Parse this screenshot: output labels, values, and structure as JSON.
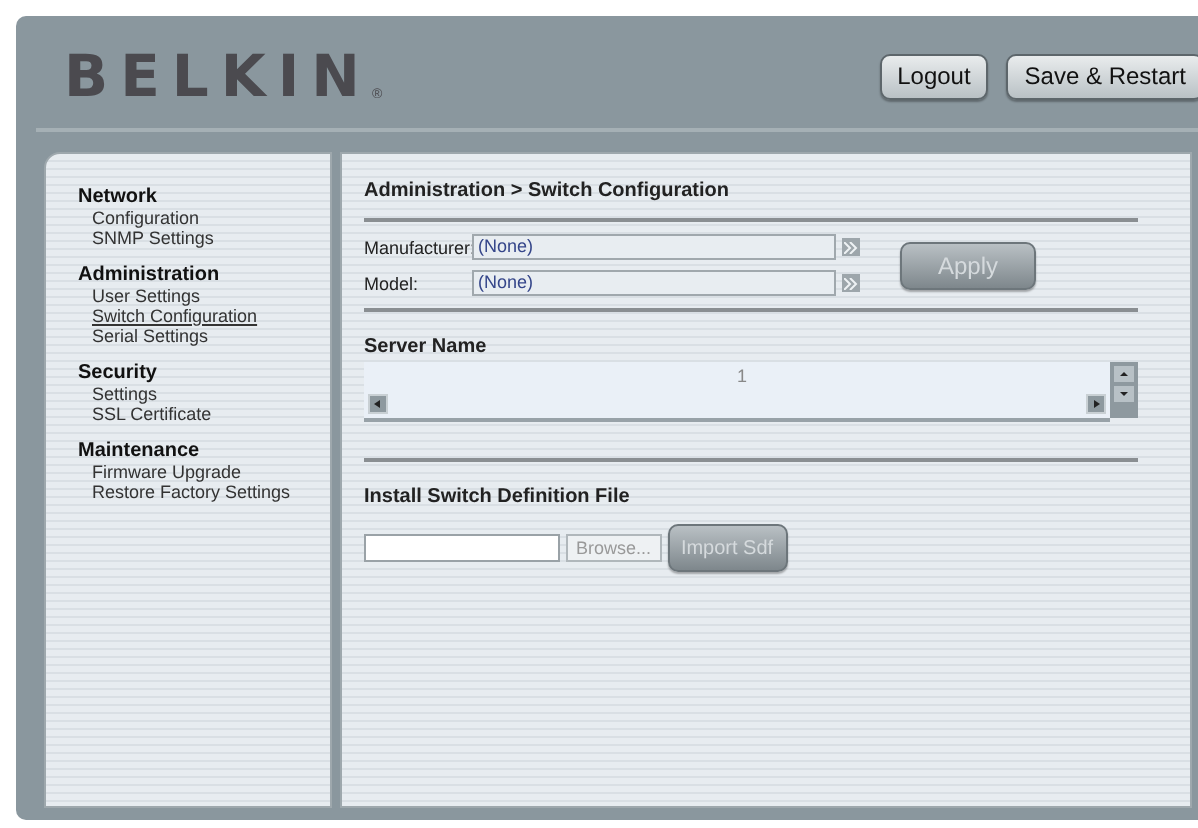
{
  "header": {
    "logo": "BELKIN",
    "logo_mark": "®",
    "buttons": [
      {
        "label": "Logout",
        "disabled": false
      },
      {
        "label": "Save & Restart",
        "disabled": false
      }
    ]
  },
  "sidebar": {
    "sections": [
      {
        "title": "Network",
        "items": [
          {
            "label": "Configuration",
            "selected": false
          },
          {
            "label": "SNMP Settings",
            "selected": false
          }
        ]
      },
      {
        "title": "Administration",
        "items": [
          {
            "label": "User Settings",
            "selected": false
          },
          {
            "label": "Switch Configuration",
            "selected": true
          },
          {
            "label": "Serial Settings",
            "selected": false
          }
        ]
      },
      {
        "title": "Security",
        "items": [
          {
            "label": "Settings",
            "selected": false
          },
          {
            "label": "SSL Certificate",
            "selected": false
          }
        ]
      },
      {
        "title": "Maintenance",
        "items": [
          {
            "label": "Firmware Upgrade",
            "selected": false
          },
          {
            "label": "Restore Factory Settings",
            "selected": false
          }
        ]
      }
    ]
  },
  "content": {
    "breadcrumb": "Administration > Switch Configuration",
    "fields": [
      {
        "label": "Manufacturer:",
        "value": "(None)"
      },
      {
        "label": "Model:",
        "value": "(None)"
      }
    ],
    "apply_button": {
      "label": "Apply",
      "disabled": true
    },
    "server_list": {
      "title": "Server Name",
      "rows": [
        "1"
      ]
    },
    "install": {
      "title": "Install Switch Definition File",
      "browse": {
        "label": "Browse...",
        "disabled": true
      },
      "import": {
        "label": "Import Sdf",
        "disabled": true
      }
    }
  }
}
